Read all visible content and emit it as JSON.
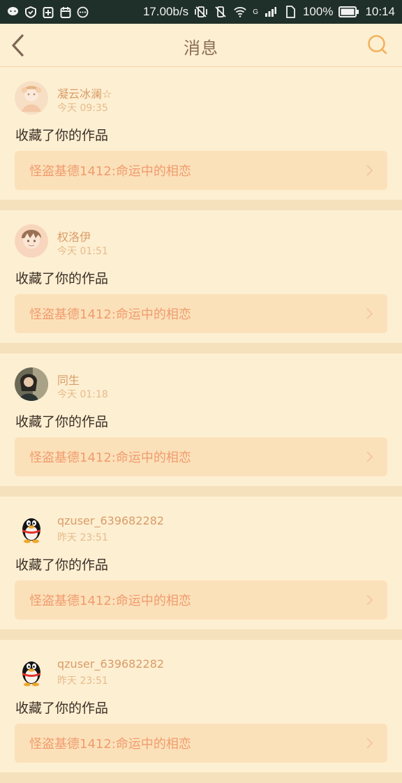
{
  "status_bar": {
    "speed": "17.00b/s",
    "network_label": "G",
    "battery": "100%",
    "time": "10:14"
  },
  "header": {
    "title": "消息"
  },
  "colors": {
    "accent": "#f09c6d",
    "name_color": "#d99c68",
    "background": "#faebcb"
  },
  "notifications": [
    {
      "user": "凝云冰澜☆",
      "time": "今天 09:35",
      "action": "收藏了你的作品",
      "work": "怪盗基德1412:命运中的相恋",
      "avatar_icon": "anime-girl-avatar"
    },
    {
      "user": "权洛伊",
      "time": "今天 01:51",
      "action": "收藏了你的作品",
      "work": "怪盗基德1412:命运中的相恋",
      "avatar_icon": "anime-boy-avatar"
    },
    {
      "user": "同生",
      "time": "今天 01:18",
      "action": "收藏了你的作品",
      "work": "怪盗基德1412:命运中的相恋",
      "avatar_icon": "photo-avatar"
    },
    {
      "user": "qzuser_639682282",
      "time": "昨天 23:51",
      "action": "收藏了你的作品",
      "work": "怪盗基德1412:命运中的相恋",
      "avatar_icon": "penguin-avatar"
    },
    {
      "user": "qzuser_639682282",
      "time": "昨天 23:51",
      "action": "收藏了你的作品",
      "work": "怪盗基德1412:命运中的相恋",
      "avatar_icon": "penguin-avatar"
    }
  ]
}
